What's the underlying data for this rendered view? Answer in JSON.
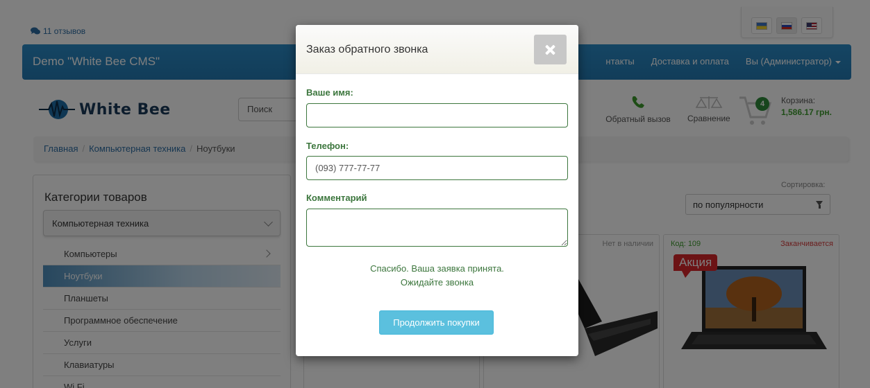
{
  "reviews": {
    "icon": "comments-icon",
    "label": "11 отзывов"
  },
  "languages": [
    {
      "code": "ua",
      "icon": "flag-ukraine-icon"
    },
    {
      "code": "ru",
      "icon": "flag-russia-icon",
      "selected": true
    },
    {
      "code": "en",
      "icon": "flag-usa-icon"
    }
  ],
  "navbar": {
    "brand": "Demo \"White Bee CMS\"",
    "items": [
      "нтакты",
      "Доставка и оплата",
      "Вы (Администратор)"
    ]
  },
  "logo": {
    "text": "White Bee"
  },
  "search": {
    "placeholder": "Поиск"
  },
  "header_actions": {
    "callback_label": "Обратный вызов",
    "compare_label": "Сравнение",
    "cart_count": "4",
    "cart_label": "Корзина:",
    "cart_sum": "1,586.17 грн."
  },
  "breadcrumb": [
    "Главная",
    "Компьютерная техника",
    "Ноутбуки"
  ],
  "categories": {
    "title": "Категории товаров",
    "selected": "Компьютерная техника",
    "items": [
      {
        "label": "Компьютеры",
        "has_children": true
      },
      {
        "label": "Ноутбуки",
        "active": true
      },
      {
        "label": "Планшеты"
      },
      {
        "label": "Программное обеспечение"
      },
      {
        "label": "Услуги"
      },
      {
        "label": "Клавиатуры"
      },
      {
        "label": "Wi Fi"
      }
    ]
  },
  "sorting": {
    "label": "Сортировка:",
    "value": "по популярности"
  },
  "products": [
    {
      "code": "",
      "status": ""
    },
    {
      "code": "",
      "status": "Нет в наличии"
    },
    {
      "code": "Код: 109",
      "status": "Заканчивается",
      "promo": "Акция"
    }
  ],
  "modal": {
    "title": "Заказ обратного звонка",
    "name_label": "Ваше имя:",
    "name_value": "",
    "phone_label": "Телефон:",
    "phone_placeholder": "(093) 777-77-77",
    "comment_label": "Комментарий",
    "comment_value": "",
    "success_line1": "Спасибо. Ваша заявка принята.",
    "success_line2": "Ожидайте звонка",
    "continue_label": "Продолжить покупки"
  },
  "colors": {
    "navbar": "#2980b9",
    "form_success": "#3c763d",
    "button_info": "#5bc0de",
    "cart_badge": "#2e8b3a",
    "promo": "#d8262a"
  }
}
